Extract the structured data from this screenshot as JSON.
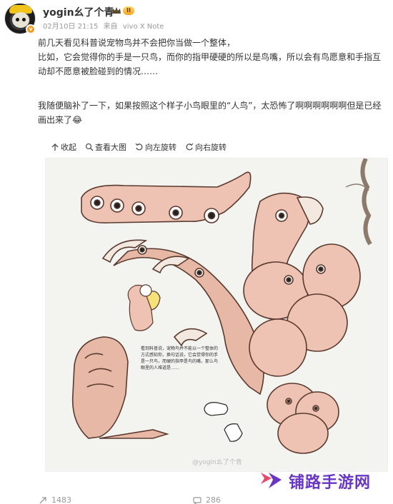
{
  "post": {
    "username": "yogin幺了个青",
    "level": "II",
    "date": "02月10日 21:15",
    "source_prefix": "来自",
    "source_device": "vivo X Note",
    "text_line1": "前几天看见科普说宠物鸟并不会把你当做一个整体，",
    "text_para2": "比如，它会觉得你的手是一只鸟，而你的指甲硬硬的所以是鸟嘴，所以会有鸟愿意和手指互动却不愿意被脸碰到的情况……",
    "text_para3": "我随便脑补了一下，如果按照这个样子小鸟眼里的“人鸟”，太恐怖了啊啊啊啊啊啊但是已经画出来了😂"
  },
  "image_toolbar": {
    "collapse": "收起",
    "view_large": "查看大图",
    "rotate_left": "向左旋转",
    "rotate_right": "向右旋转"
  },
  "image": {
    "note": "看到科普说，宠物鸟并不能以一个整体的方式感知你，换句话说，它会觉得你的手是一只鸟，而硬的指甲是鸟的嘴，那么鸟眼里的人难道是……",
    "watermark": "@yogin幺了个青"
  },
  "site_logo": {
    "text": "铺路手游网"
  },
  "footer": {
    "reposts": "1483",
    "comments": "286"
  }
}
